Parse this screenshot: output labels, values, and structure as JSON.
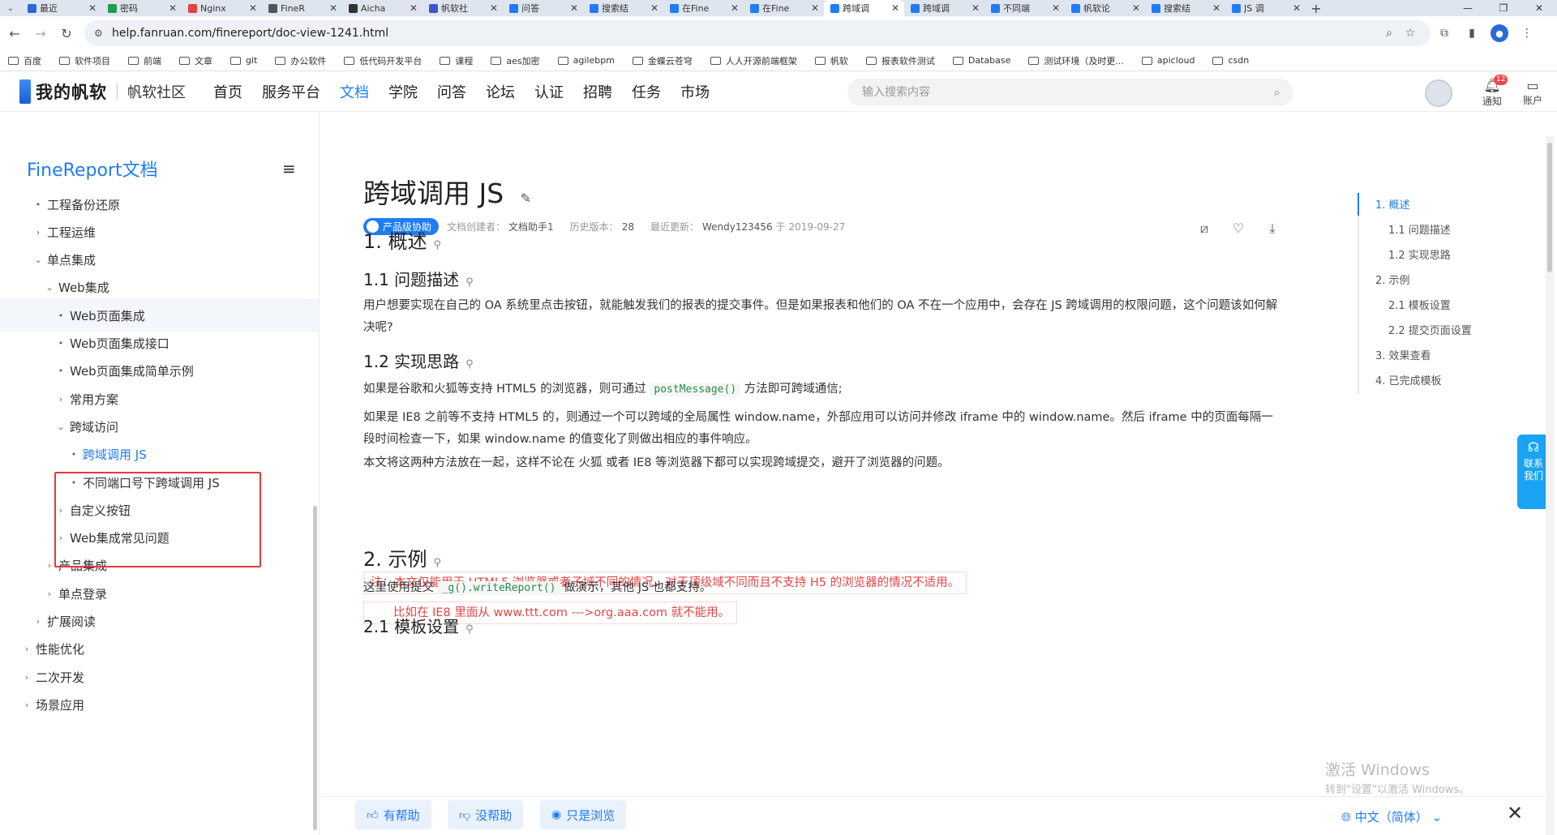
{
  "browser": {
    "tabs": [
      {
        "title": "最近",
        "color": "#2a6ad8"
      },
      {
        "title": "密码",
        "color": "#1f9d4f"
      },
      {
        "title": "Nginx",
        "color": "#e2433a"
      },
      {
        "title": "FineR",
        "color": "#555555"
      },
      {
        "title": "Aicha",
        "color": "#333333"
      },
      {
        "title": "帆软社",
        "color": "#3e57c7"
      },
      {
        "title": "问答",
        "color": "#1f7cf5"
      },
      {
        "title": "搜索结",
        "color": "#1f7cf5"
      },
      {
        "title": "在Fine",
        "color": "#1f7cf5"
      },
      {
        "title": "在Fine",
        "color": "#1f7cf5"
      },
      {
        "title": "跨域调",
        "color": "#1f7cf5"
      },
      {
        "title": "跨域调",
        "color": "#1f7cf5"
      },
      {
        "title": "不同端",
        "color": "#1f7cf5"
      },
      {
        "title": "帆软论",
        "color": "#1f7cf5"
      },
      {
        "title": "搜索结",
        "color": "#1f7cf5"
      },
      {
        "title": "JS 调",
        "color": "#1f7cf5"
      }
    ],
    "active_tab_index": 10,
    "url": "help.fanruan.com/finereport/doc-view-1241.html",
    "bookmarks": [
      "百度",
      "软件项目",
      "前端",
      "文章",
      "git",
      "办公软件",
      "低代码开发平台",
      "课程",
      "aes加密",
      "agilebpm",
      "金蝶云苍穹",
      "人人开源前端框架",
      "帆软",
      "报表软件测试",
      "Database",
      "测试环境（及时更...",
      "apicloud",
      "csdn"
    ]
  },
  "site": {
    "logo": "我的帆软",
    "community": "帆软社区",
    "nav": [
      "首页",
      "服务平台",
      "文档",
      "学院",
      "问答",
      "论坛",
      "认证",
      "招聘",
      "任务",
      "市场"
    ],
    "active_nav_index": 2,
    "search_placeholder": "输入搜索内容",
    "notify_label": "通知",
    "notify_count": "12",
    "account_label": "账户"
  },
  "sidebar": {
    "title": "FineReport文档",
    "items": [
      {
        "label": "工程备份还原",
        "mark": "•",
        "indent": 0
      },
      {
        "label": "工程运维",
        "mark": "›",
        "indent": 0
      },
      {
        "label": "单点集成",
        "mark": "⌄",
        "indent": 0
      },
      {
        "label": "Web集成",
        "mark": "⌄",
        "indent": 1
      },
      {
        "label": "Web页面集成",
        "mark": "•",
        "indent": 2,
        "state": "sel"
      },
      {
        "label": "Web页面集成接口",
        "mark": "•",
        "indent": 2
      },
      {
        "label": "Web页面集成简单示例",
        "mark": "•",
        "indent": 2
      },
      {
        "label": "常用方案",
        "mark": "›",
        "indent": 2
      },
      {
        "label": "跨域访问",
        "mark": "⌄",
        "indent": 2
      },
      {
        "label": "跨域调用 JS",
        "mark": "•",
        "indent": 3,
        "state": "cur"
      },
      {
        "label": "不同端口号下跨域调用 JS",
        "mark": "•",
        "indent": 3
      },
      {
        "label": "自定义按钮",
        "mark": "›",
        "indent": 2
      },
      {
        "label": "Web集成常见问题",
        "mark": "›",
        "indent": 2
      },
      {
        "label": "产品集成",
        "mark": "›",
        "indent": 1
      },
      {
        "label": "单点登录",
        "mark": "›",
        "indent": 1
      },
      {
        "label": "扩展阅读",
        "mark": "›",
        "indent": 0
      },
      {
        "label": "性能优化",
        "mark": "›",
        "indent": -1
      },
      {
        "label": "二次开发",
        "mark": "›",
        "indent": -1
      },
      {
        "label": "场景应用",
        "mark": "›",
        "indent": -1
      }
    ]
  },
  "article": {
    "title": "跨域调用 JS",
    "product_tag": "产品级协助",
    "creator_label": "文档创建者：",
    "creator": "文档助手1",
    "history_label": "历史版本：",
    "history": "28",
    "updated_label": "最近更新：",
    "updated_by": "Wendy123456",
    "updated_at": "于 2019-09-27",
    "s1": "1. 概述",
    "s1_1": "1.1 问题描述",
    "p1": "用户想要实现在自己的 OA 系统里点击按钮，就能触发我们的报表的提交事件。但是如果报表和他们的 OA 不在一个应用中，会存在 JS 跨域调用的权限问题，这个问题该如何解决呢?",
    "s1_2": "1.2 实现思路",
    "p2a": "如果是谷歌和火狐等支持 HTML5 的浏览器，则可通过",
    "p2_code": "postMessage()",
    "p2b": "方法即可跨域通信;",
    "p3": "如果是 IE8 之前等不支持 HTML5 的，则通过一个可以跨域的全局属性 window.name，外部应用可以访问并修改 iframe 中的 window.name。然后 iframe 中的页面每隔一段时间检查一下，如果 window.name 的值变化了则做出相应的事件响应。",
    "p4": "本文将这两种方法放在一起，这样不论在 火狐 或者 IE8 等浏览器下都可以实现跨域提交，避开了浏览器的问题。",
    "note1": "注：本文仅能用于 HTML5 浏览器或者子域不同的情况，对于顶级域不同而且不支持 H5 的浏览器的情况不适用。",
    "note2": "比如在 IE8 里面从 www.ttt.com --->org.aaa.com 就不能用。",
    "s2": "2. 示例",
    "p5a": "这里使用提交",
    "p5_code": "_g().writeReport()",
    "p5b": "做演示，其他 JS 也都支持。",
    "s2_1": "2.1 模板设置"
  },
  "toc": [
    {
      "label": "1. 概述",
      "level": 1,
      "current": true
    },
    {
      "label": "1.1 问题描述",
      "level": 2
    },
    {
      "label": "1.2 实现思路",
      "level": 2
    },
    {
      "label": "2. 示例",
      "level": 1
    },
    {
      "label": "2.1 模板设置",
      "level": 2
    },
    {
      "label": "2.2 提交页面设置",
      "level": 2
    },
    {
      "label": "3. 效果查看",
      "level": 1
    },
    {
      "label": "4. 已完成模板",
      "level": 1
    }
  ],
  "contact": "联系我们",
  "watermark": {
    "line1": "激活 Windows",
    "line2": "转到\"设置\"以激活 Windows。"
  },
  "feedback": {
    "helpful": "有帮助",
    "not_helpful": "没帮助",
    "just_browsing": "只是浏览",
    "language": "中文（简体）"
  }
}
